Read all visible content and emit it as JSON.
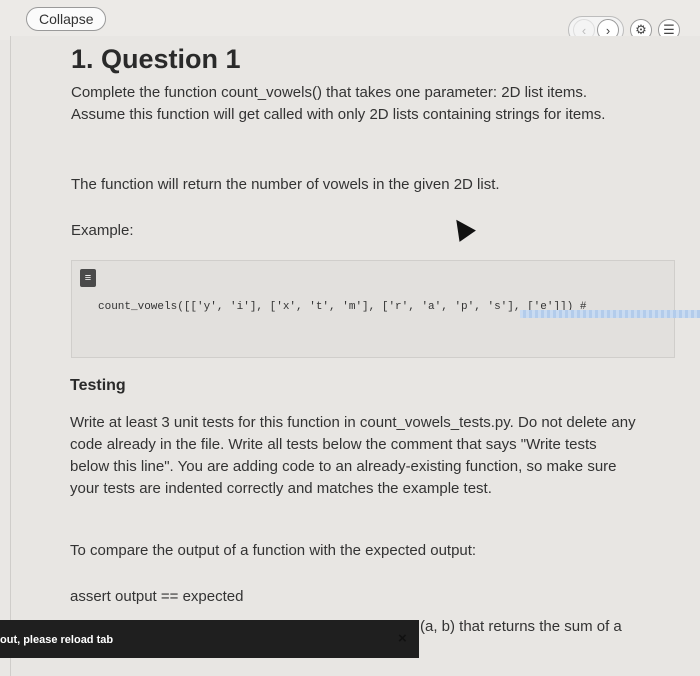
{
  "topbar": {
    "collapse_label": "Collapse",
    "icons": {
      "prev": "‹",
      "next": "›",
      "settings": "⚙",
      "list": "☰"
    }
  },
  "question": {
    "title": "1. Question 1",
    "p1": "Complete the function count_vowels() that takes one parameter: 2D list items. Assume this function will get called with only 2D lists containing strings for items.",
    "p2": "The function will return the number of vowels in the given 2D list.",
    "example_label": "Example:",
    "code": "count_vowels([['y', 'i'], ['x', 't', 'm'], ['r', 'a', 'p', 's'], ['e']]) #"
  },
  "testing": {
    "heading": "Testing",
    "p1": "Write at least 3 unit tests for this function in count_vowels_tests.py. Do not delete any code already in the file. Write all tests below the comment that says \"Write tests below this line\". You are adding code to an already-existing function, so make sure your tests are indented correctly and matches the example test.",
    "p2": "To compare the output of a function with the expected output:",
    "assert_line": "assert output == expected",
    "trailing": "(a, b) that returns the sum of a"
  },
  "toast": {
    "text": "out, please reload tab",
    "close": "×"
  }
}
